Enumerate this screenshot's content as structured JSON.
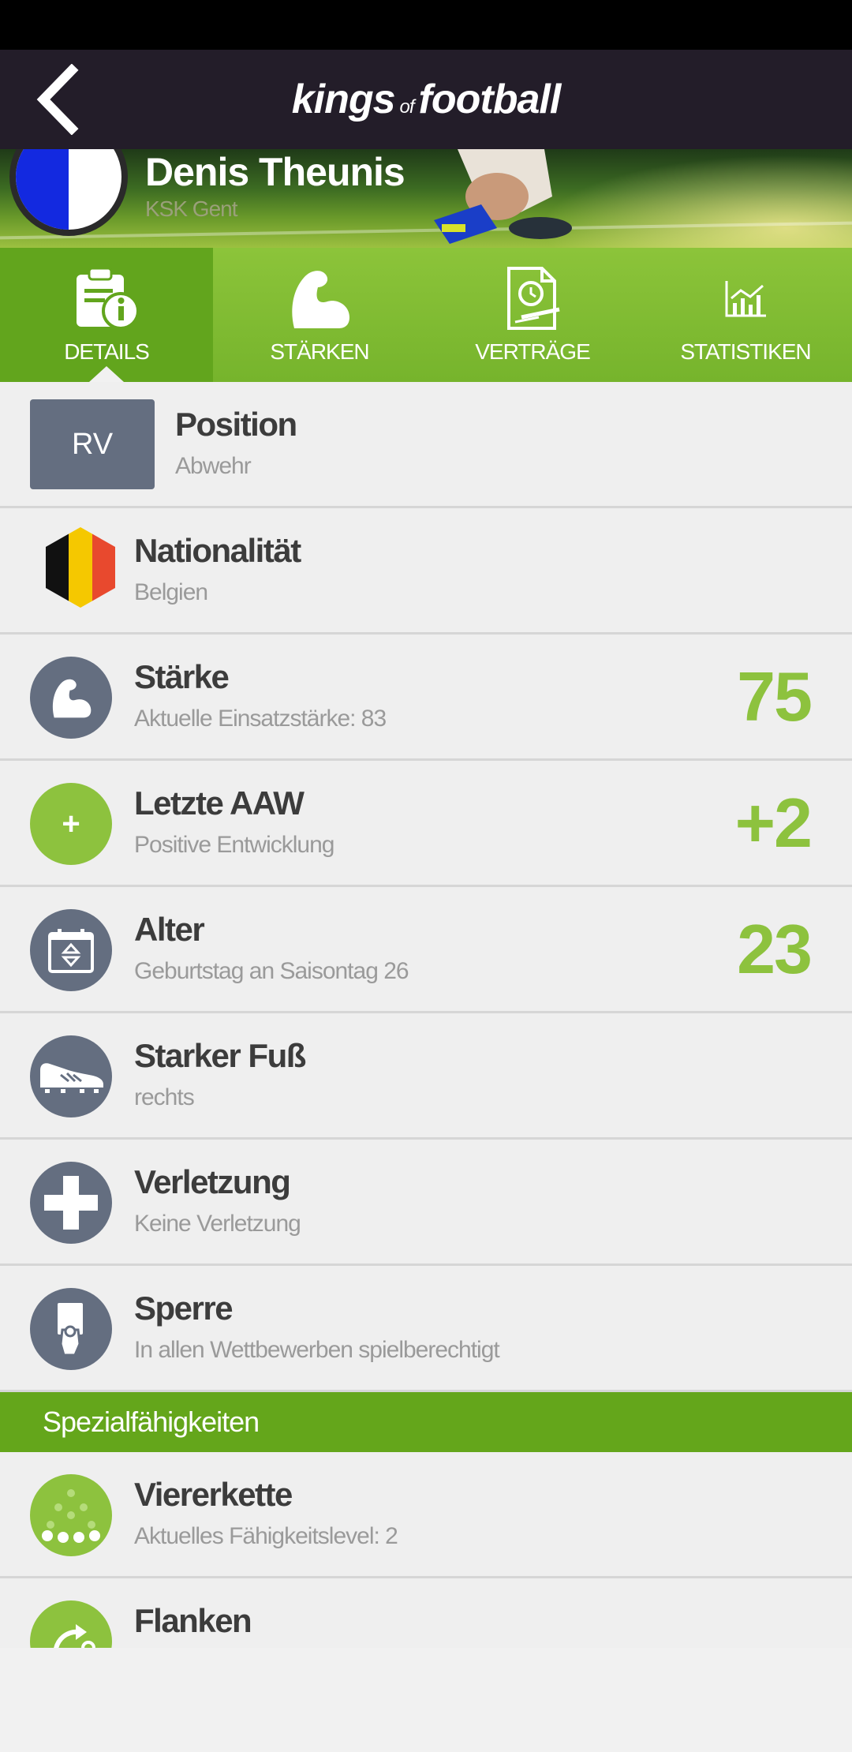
{
  "header": {
    "logo_left": "kings",
    "logo_of": "of",
    "logo_right": "football"
  },
  "player": {
    "name": "Denis Theunis",
    "club": "KSK Gent"
  },
  "tabs": [
    {
      "label": "DETAILS",
      "icon": "clipboard-info-icon",
      "active": true
    },
    {
      "label": "STÄRKEN",
      "icon": "flexed-arm-icon",
      "active": false
    },
    {
      "label": "VERTRÄGE",
      "icon": "contract-icon",
      "active": false
    },
    {
      "label": "STATISTIKEN",
      "icon": "chart-icon",
      "active": false
    }
  ],
  "details": {
    "position": {
      "badge": "RV",
      "title": "Position",
      "sub": "Abwehr"
    },
    "nationality": {
      "title": "Nationalität",
      "sub": "Belgien"
    },
    "strength": {
      "title": "Stärke",
      "sub": "Aktuelle Einsatzstärke: 83",
      "value": "75"
    },
    "last_aaw": {
      "title": "Letzte AAW",
      "sub": "Positive Entwicklung",
      "value": "+2",
      "icon_text": "+"
    },
    "age": {
      "title": "Alter",
      "sub": "Geburtstag an Saisontag 26",
      "value": "23"
    },
    "foot": {
      "title": "Starker Fuß",
      "sub": "rechts"
    },
    "injury": {
      "title": "Verletzung",
      "sub": "Keine Verletzung"
    },
    "suspension": {
      "title": "Sperre",
      "sub": "In allen Wettbewerben spielberechtigt"
    }
  },
  "special": {
    "header": "Spezialfähigkeiten",
    "items": [
      {
        "title": "Viererkette",
        "sub": "Aktuelles Fähigkeitslevel: 2"
      },
      {
        "title": "Flanken",
        "sub": ""
      }
    ]
  },
  "colors": {
    "accent_green": "#8dc23e",
    "dark_header": "#231d29",
    "icon_gray": "#646e80"
  }
}
